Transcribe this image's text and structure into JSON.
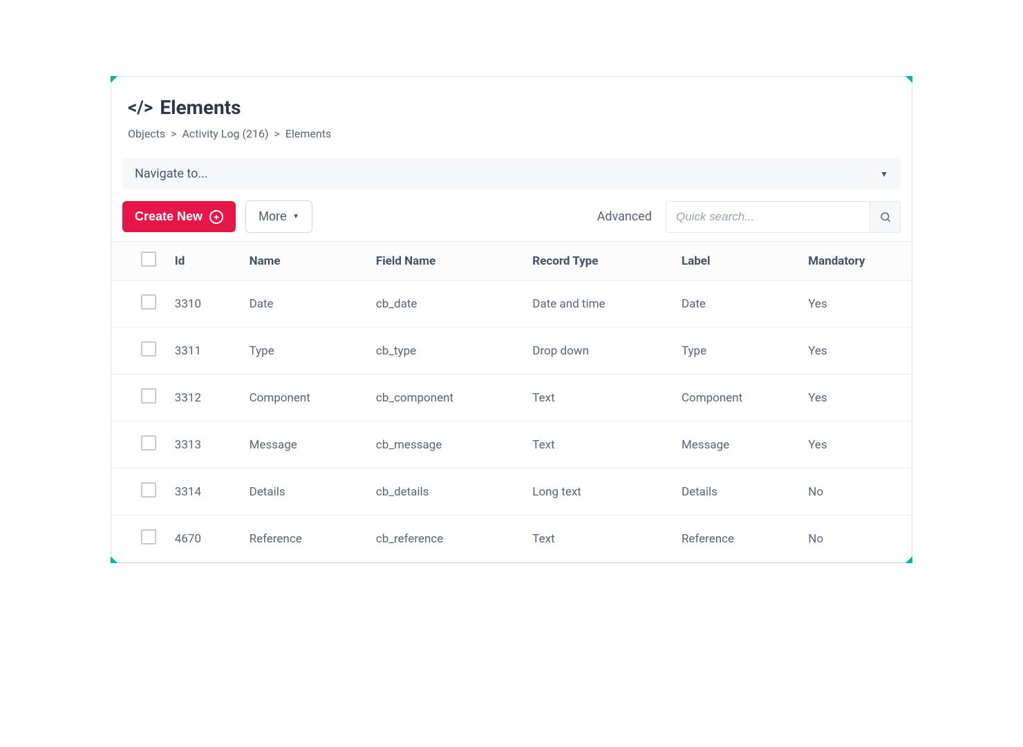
{
  "header": {
    "icon_label": "</>",
    "title": "Elements"
  },
  "breadcrumb": {
    "items": [
      "Objects",
      "Activity Log (216)",
      "Elements"
    ],
    "separator": ">"
  },
  "navigate": {
    "label": "Navigate to..."
  },
  "toolbar": {
    "create_label": "Create New",
    "more_label": "More",
    "advanced_label": "Advanced",
    "search_placeholder": "Quick search..."
  },
  "table": {
    "columns": {
      "id": "Id",
      "name": "Name",
      "field_name": "Field Name",
      "record_type": "Record Type",
      "label": "Label",
      "mandatory": "Mandatory"
    },
    "rows": [
      {
        "id": "3310",
        "name": "Date",
        "field_name": "cb_date",
        "record_type": "Date and time",
        "label": "Date",
        "mandatory": "Yes"
      },
      {
        "id": "3311",
        "name": "Type",
        "field_name": "cb_type",
        "record_type": "Drop down",
        "label": "Type",
        "mandatory": "Yes"
      },
      {
        "id": "3312",
        "name": "Component",
        "field_name": "cb_component",
        "record_type": "Text",
        "label": "Component",
        "mandatory": "Yes"
      },
      {
        "id": "3313",
        "name": "Message",
        "field_name": "cb_message",
        "record_type": "Text",
        "label": "Message",
        "mandatory": "Yes"
      },
      {
        "id": "3314",
        "name": "Details",
        "field_name": "cb_details",
        "record_type": "Long text",
        "label": "Details",
        "mandatory": "No"
      },
      {
        "id": "4670",
        "name": "Reference",
        "field_name": "cb_reference",
        "record_type": "Text",
        "label": "Reference",
        "mandatory": "No"
      }
    ]
  }
}
